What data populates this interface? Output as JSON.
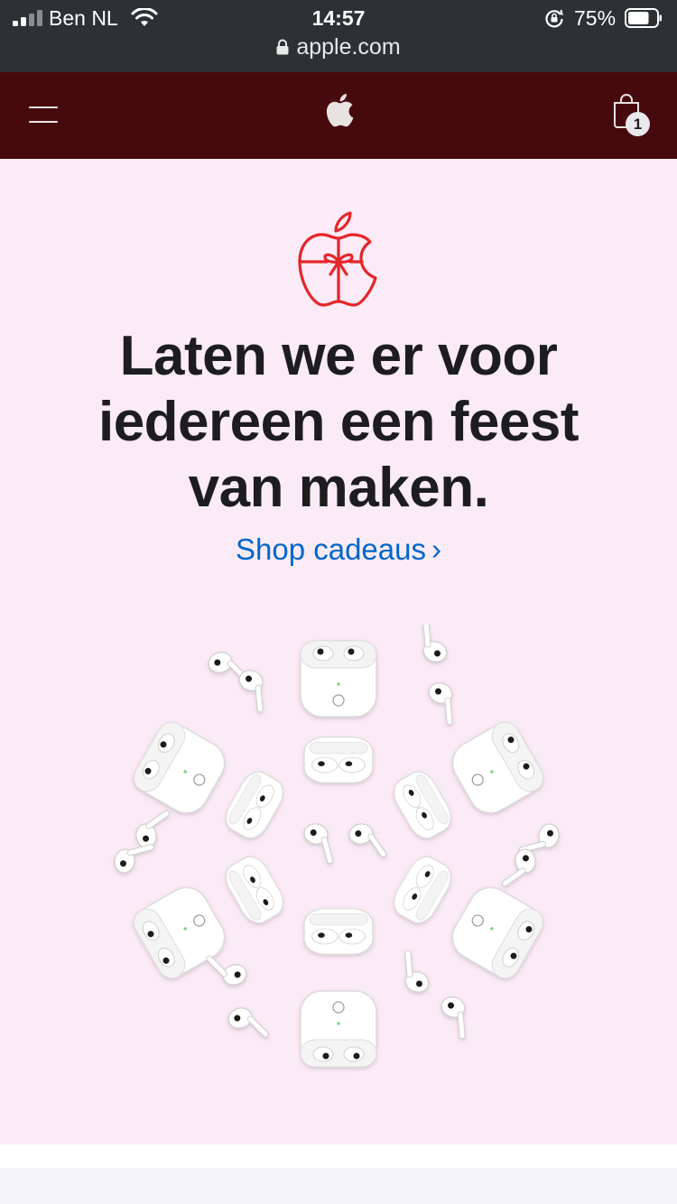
{
  "status": {
    "carrier": "Ben NL",
    "time": "14:57",
    "battery": "75%",
    "battery_level": 0.75
  },
  "browser": {
    "url": "apple.com"
  },
  "nav": {
    "bag_count": "1"
  },
  "hero": {
    "headline_line1": "Laten we er voor",
    "headline_line2": "iedereen een feest",
    "headline_line3": "van maken.",
    "link_label": "Shop cadeaus",
    "link_chevron": "›"
  },
  "colors": {
    "nav_bg": "#470a0c",
    "hero_bg": "#fbebf6",
    "accent_red": "#e3262b",
    "link_blue": "#0066cc"
  },
  "icons": [
    "signal-icon",
    "wifi-icon",
    "rotation-lock-icon",
    "battery-icon",
    "padlock-icon",
    "menu-icon",
    "apple-logo-icon",
    "shopping-bag-icon",
    "gift-apple-icon"
  ]
}
